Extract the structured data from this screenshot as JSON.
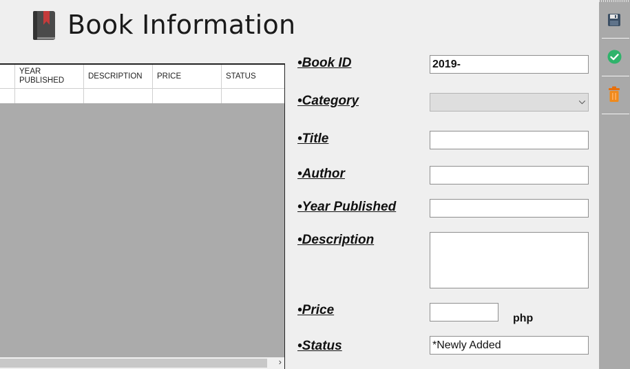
{
  "header": {
    "title": "Book Information",
    "icon": "book-icon"
  },
  "table": {
    "columns": [
      "YEAR PUBLISHED",
      "DESCRIPTION",
      "PRICE",
      "STATUS"
    ],
    "rows": [
      [
        "",
        "",
        "",
        ""
      ]
    ]
  },
  "form": {
    "book_id": {
      "label": "•Book ID",
      "value": "2019-"
    },
    "category": {
      "label": "•Category",
      "value": ""
    },
    "title": {
      "label": "•Title",
      "value": ""
    },
    "author": {
      "label": "•Author",
      "value": ""
    },
    "year_published": {
      "label": "•Year Published",
      "value": ""
    },
    "description": {
      "label": "•Description",
      "value": ""
    },
    "price": {
      "label": "•Price",
      "value": "",
      "unit": "php"
    },
    "status": {
      "label": "•Status",
      "value": "*Newly Added"
    }
  },
  "toolbar": {
    "items": [
      {
        "name": "save",
        "icon": "floppy-disk-icon"
      },
      {
        "name": "confirm",
        "icon": "checkmark-circle-icon",
        "color": "#2fb36b"
      },
      {
        "name": "delete",
        "icon": "trash-can-icon",
        "color": "#f07d12"
      }
    ]
  },
  "colors": {
    "background": "#efefef",
    "grid_empty": "#ababab",
    "toolbar": "#a9a9a9"
  }
}
